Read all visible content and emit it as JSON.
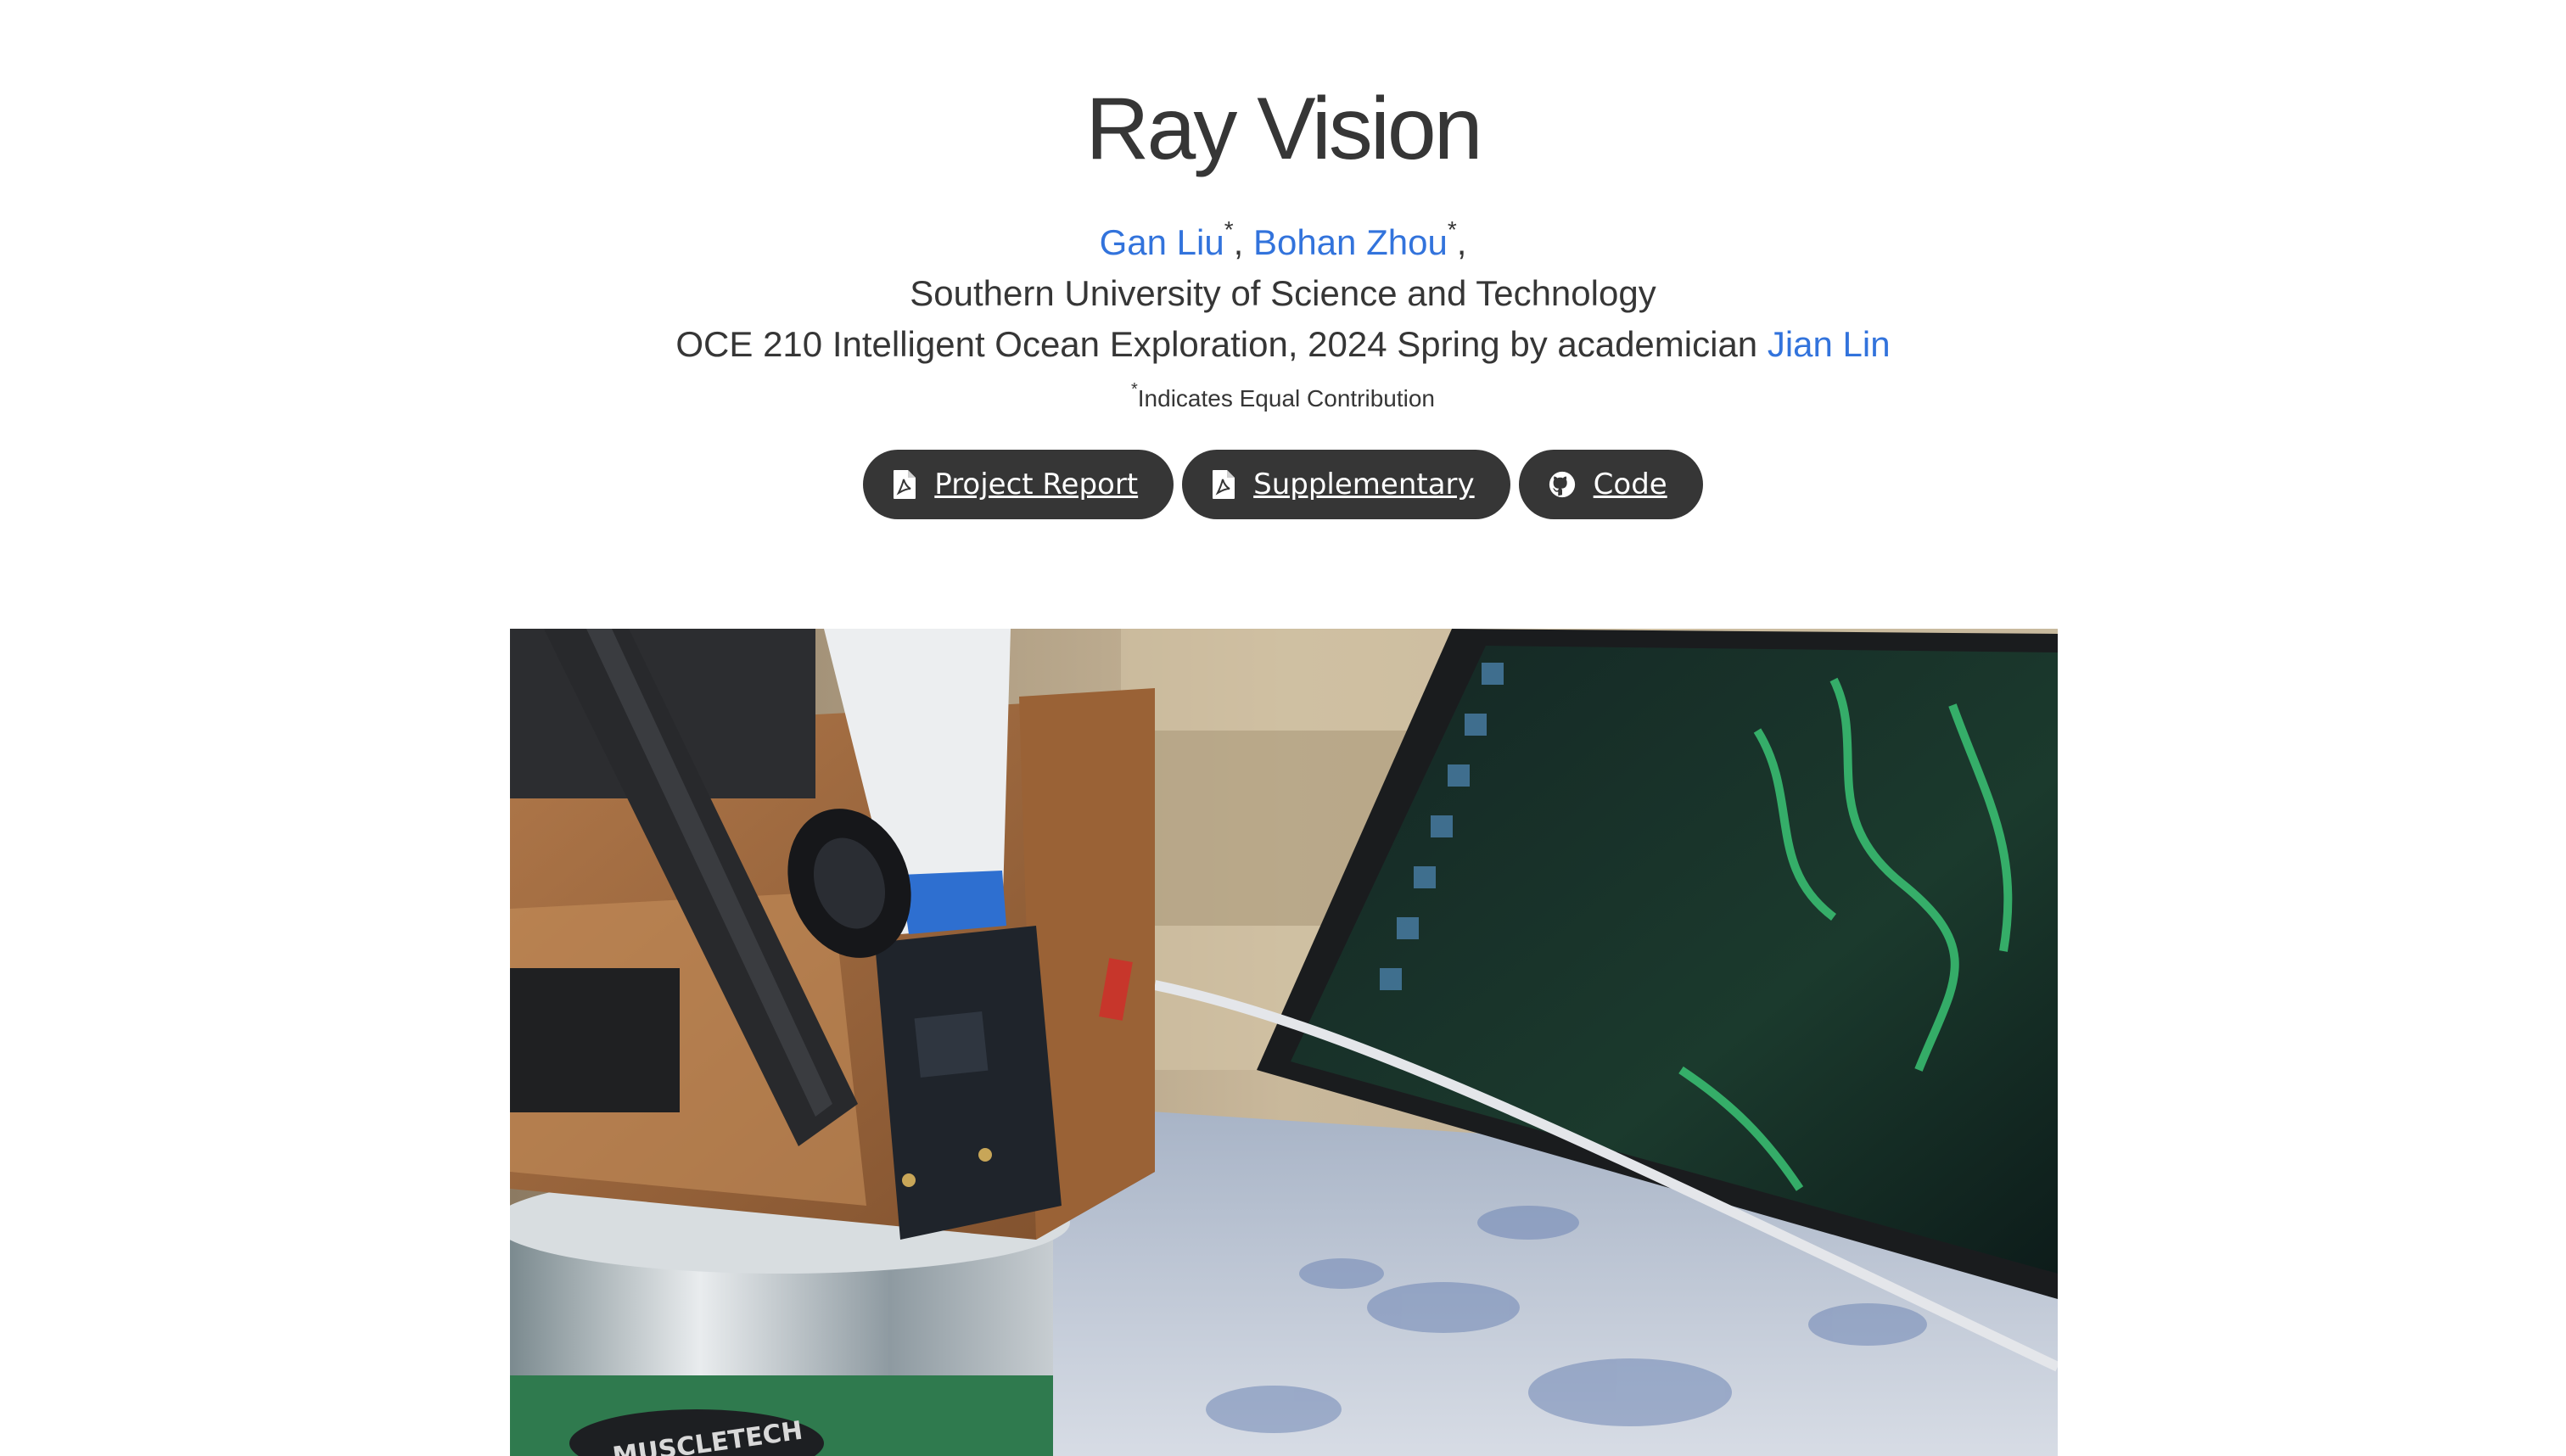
{
  "title": "Ray Vision",
  "authors": [
    {
      "name": "Gan Liu",
      "mark": "*"
    },
    {
      "name": "Bohan Zhou",
      "mark": "*"
    }
  ],
  "author_separator": ",",
  "affiliation": "Southern University of Science and Technology",
  "course": {
    "text": "OCE 210 Intelligent Ocean Exploration, 2024 Spring by academician",
    "link": "Jian Lin"
  },
  "note": {
    "mark": "*",
    "text": "Indicates Equal Contribution"
  },
  "buttons": [
    {
      "label": "Project Report",
      "icon": "pdf-icon"
    },
    {
      "label": "Supplementary",
      "icon": "pdf-icon"
    },
    {
      "label": "Code",
      "icon": "github-icon"
    }
  ],
  "photo": {
    "logo_text": "MUSCLETECH"
  },
  "colors": {
    "link": "#3273dc",
    "button": "#363636",
    "text": "#363636"
  }
}
